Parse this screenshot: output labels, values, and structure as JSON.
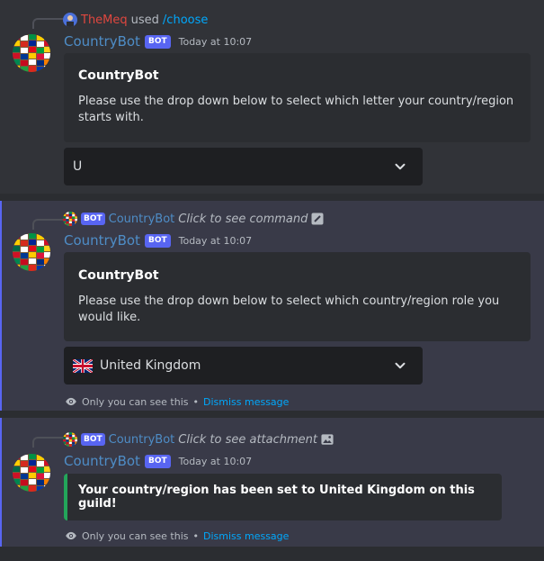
{
  "colors": {
    "background": "#313338",
    "embed": "#2b2d31",
    "ephemeral_bg": "#393a48",
    "accent": "#5865f2",
    "link": "#00a8fc",
    "author": "#4e8dc7",
    "success": "#23a55a"
  },
  "messages": [
    {
      "reply": {
        "user": "TheMeq",
        "used": "used",
        "command": "/choose"
      },
      "author": "CountryBot",
      "bot_tag": "BOT",
      "time": "Today at 10:07",
      "embed": {
        "title": "CountryBot",
        "description": "Please use the drop down below to select which letter your country/region starts with."
      },
      "select": {
        "value": "U",
        "icon": "chevron-down-icon"
      }
    },
    {
      "reply": {
        "bot_tag": "BOT",
        "name": "CountryBot",
        "text": "Click to see command",
        "icon": "slash-command-icon"
      },
      "author": "CountryBot",
      "bot_tag": "BOT",
      "time": "Today at 10:07",
      "embed": {
        "title": "CountryBot",
        "description": "Please use the drop down below to select which country/region role you would like."
      },
      "select": {
        "value": "United Kingdom",
        "flag": "uk-flag-icon",
        "icon": "chevron-down-icon"
      },
      "ephemeral": {
        "text": "Only you can see this",
        "bullet": "•",
        "dismiss": "Dismiss message"
      }
    },
    {
      "reply": {
        "bot_tag": "BOT",
        "name": "CountryBot",
        "text": "Click to see attachment",
        "icon": "image-icon"
      },
      "author": "CountryBot",
      "bot_tag": "BOT",
      "time": "Today at 10:07",
      "result": "Your country/region has been set to United Kingdom on this guild!",
      "ephemeral": {
        "text": "Only you can see this",
        "bullet": "•",
        "dismiss": "Dismiss message"
      }
    }
  ]
}
